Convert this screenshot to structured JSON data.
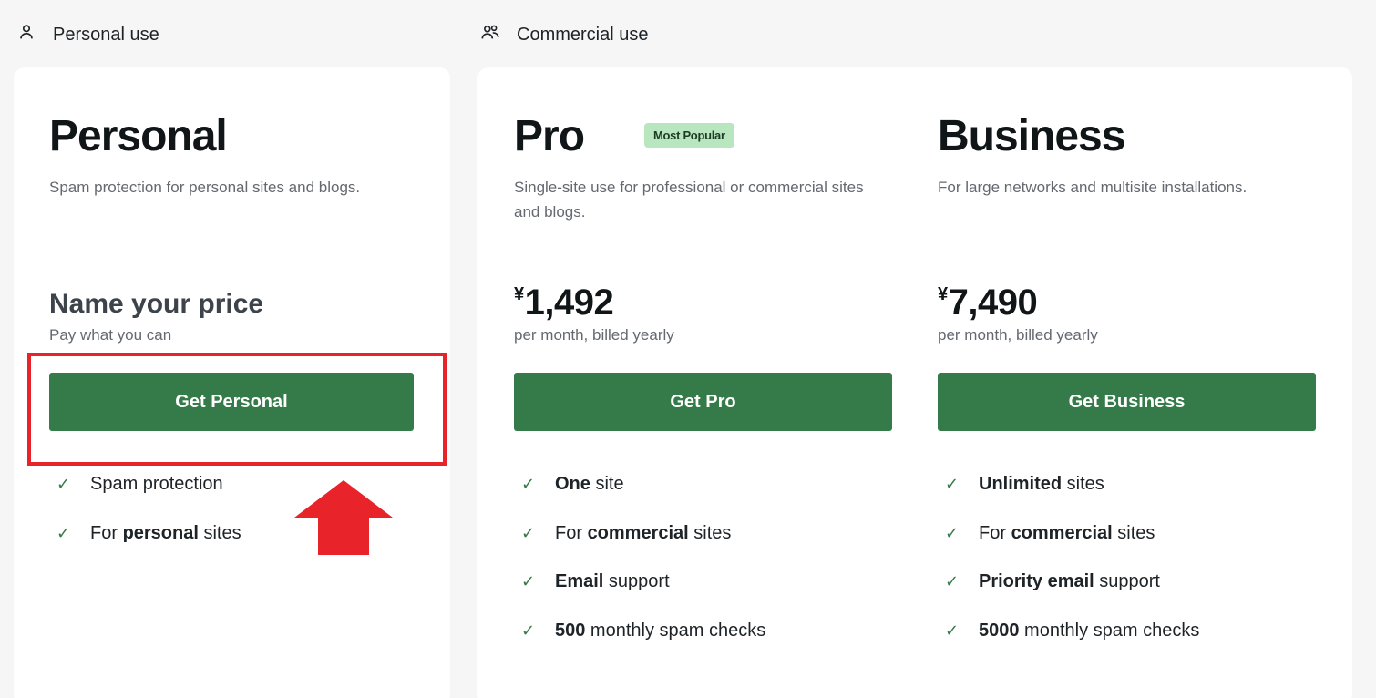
{
  "sections": {
    "personal": {
      "label": "Personal use",
      "icon": "person-icon"
    },
    "commercial": {
      "label": "Commercial use",
      "icon": "people-icon"
    }
  },
  "plans": {
    "personal": {
      "title": "Personal",
      "description": "Spam protection for personal sites and blogs.",
      "price_heading": "Name your price",
      "price_note": "Pay what you can",
      "cta": "Get Personal",
      "features": [
        {
          "pre": "",
          "bold": "",
          "post": "Spam protection"
        },
        {
          "pre": "For ",
          "bold": "personal",
          "post": " sites"
        }
      ]
    },
    "pro": {
      "title": "Pro",
      "badge": "Most Popular",
      "description": "Single-site use for professional or commercial sites and blogs.",
      "currency": "¥",
      "price": "1,492",
      "price_note": "per month, billed yearly",
      "cta": "Get Pro",
      "features": [
        {
          "pre": "",
          "bold": "One",
          "post": " site"
        },
        {
          "pre": "For ",
          "bold": "commercial",
          "post": " sites"
        },
        {
          "pre": "",
          "bold": "Email",
          "post": " support"
        },
        {
          "pre": "",
          "bold": "500",
          "post": " monthly spam checks"
        }
      ]
    },
    "business": {
      "title": "Business",
      "description": "For large networks and multisite installations.",
      "currency": "¥",
      "price": "7,490",
      "price_note": "per month, billed yearly",
      "cta": "Get Business",
      "features": [
        {
          "pre": "",
          "bold": "Unlimited",
          "post": " sites"
        },
        {
          "pre": "For ",
          "bold": "commercial",
          "post": " sites"
        },
        {
          "pre": "",
          "bold": "Priority email",
          "post": " support"
        },
        {
          "pre": "",
          "bold": "5000",
          "post": " monthly spam checks"
        }
      ]
    }
  },
  "colors": {
    "brand_green": "#357b49",
    "badge_bg": "#b8e6bf",
    "annotation_red": "#e8232a",
    "page_bg": "#f6f6f6"
  },
  "annotation": {
    "highlight": "red-outline-box",
    "pointer": "red-up-arrow"
  }
}
